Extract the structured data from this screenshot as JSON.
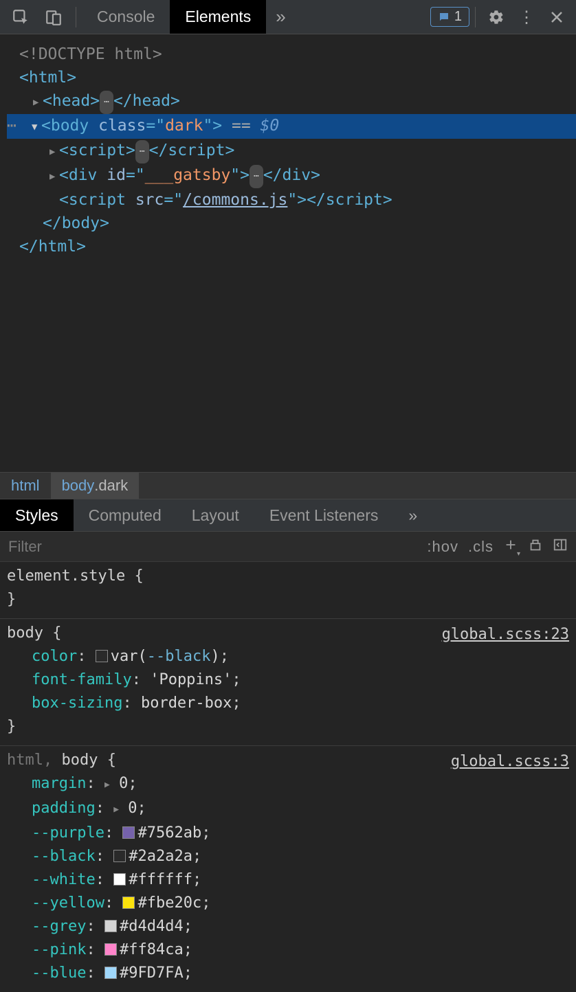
{
  "toolbar": {
    "tabs": [
      "Console",
      "Elements"
    ],
    "activeTab": "Elements",
    "badgeCount": "1"
  },
  "dom": {
    "doctype": "<!DOCTYPE html>",
    "htmlOpen": "html",
    "headOpen": "head",
    "headClose": "head",
    "bodyTag": "body",
    "bodyAttrName": "class",
    "bodyAttrValue": "dark",
    "selMarker": " == ",
    "selDollar": "$0",
    "scriptTag": "script",
    "divTag": "div",
    "divAttrName": "id",
    "divAttrValue": "___gatsby",
    "scriptSrcAttr": "src",
    "scriptSrcVal": "/commons.js",
    "bodyClose": "body",
    "htmlClose": "html"
  },
  "crumbs": {
    "c0": "html",
    "c1_tag": "body",
    "c1_cls": ".dark"
  },
  "subtabs": {
    "t0": "Styles",
    "t1": "Computed",
    "t2": "Layout",
    "t3": "Event Listeners"
  },
  "filter": {
    "placeholder": "Filter",
    "hov": ":hov",
    "cls": ".cls"
  },
  "rules": {
    "r0": {
      "selector": "element.style"
    },
    "r1": {
      "selector": "body",
      "src": "global.scss:23",
      "d0_prop": "color",
      "d0_val_fn": "var(",
      "d0_val_var": "--black",
      "d0_val_close": ")",
      "d1_prop": "font-family",
      "d1_val": "'Poppins'",
      "d2_prop": "box-sizing",
      "d2_val": "border-box"
    },
    "r2": {
      "selector_dim": "html, ",
      "selector": "body",
      "src": "global.scss:3",
      "d0_prop": "margin",
      "d0_val": "0",
      "d1_prop": "padding",
      "d1_val": "0",
      "d2_prop": "--purple",
      "d2_val": "#7562ab",
      "d2_swatch": "#7562ab",
      "d3_prop": "--black",
      "d3_val": "#2a2a2a",
      "d3_swatch": "#2a2a2a",
      "d4_prop": "--white",
      "d4_val": "#ffffff",
      "d4_swatch": "#ffffff",
      "d5_prop": "--yellow",
      "d5_val": "#fbe20c",
      "d5_swatch": "#fbe20c",
      "d6_prop": "--grey",
      "d6_val": "#d4d4d4",
      "d6_swatch": "#d4d4d4",
      "d7_prop": "--pink",
      "d7_val": "#ff84ca",
      "d7_swatch": "#ff84ca",
      "d8_prop": "--blue",
      "d8_val": "#9FD7FA",
      "d8_swatch": "#9FD7FA"
    }
  }
}
